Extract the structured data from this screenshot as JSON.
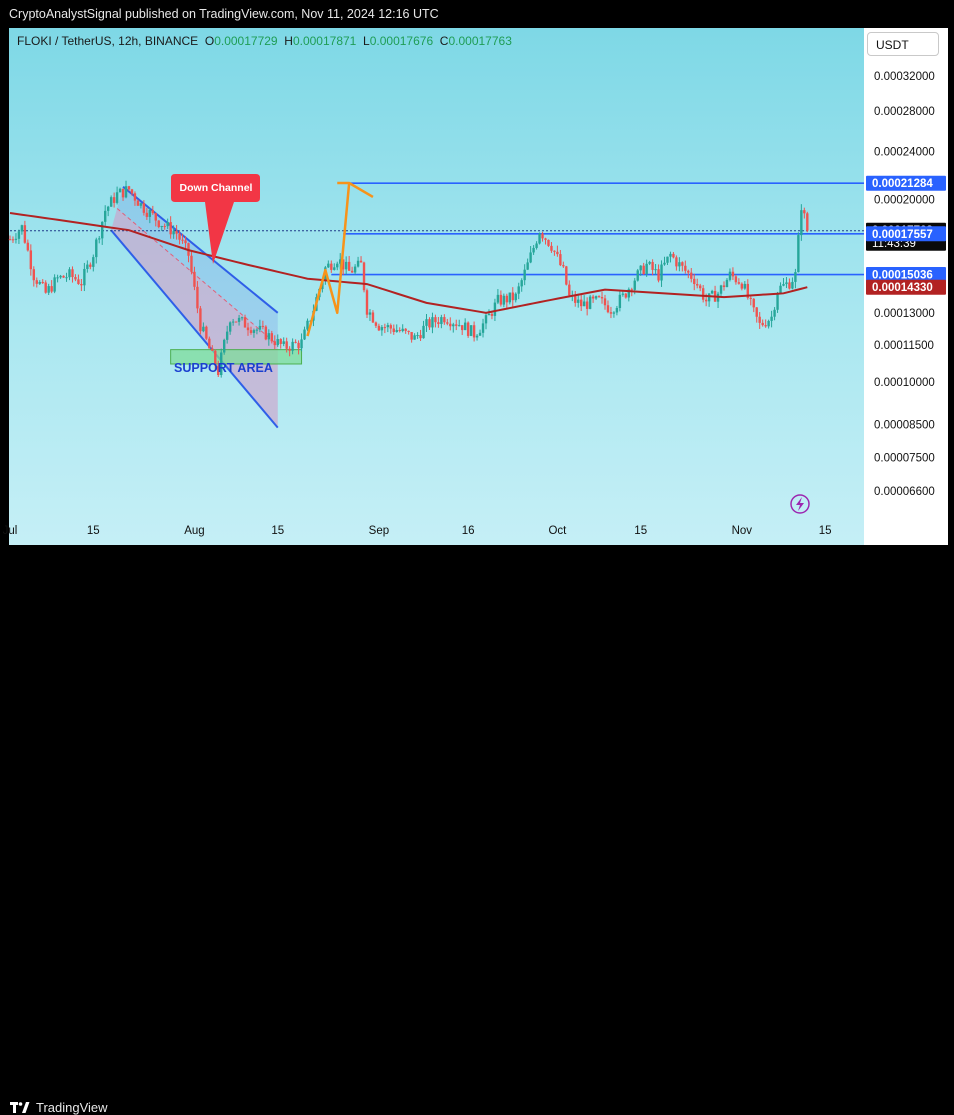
{
  "header": {
    "publisher_line": "CryptoAnalystSignal published on TradingView.com, Nov 11, 2024 12:16 UTC"
  },
  "legend": {
    "symbol": "FLOKI / TetherUS, 12h, BINANCE",
    "o_label": "O",
    "o_value": "0.00017729",
    "h_label": "H",
    "h_value": "0.00017871",
    "l_label": "L",
    "l_value": "0.00017676",
    "c_label": "C",
    "c_value": "0.00017763"
  },
  "currency_button": "USDT",
  "footer": {
    "brand": "TradingView"
  },
  "colors": {
    "up": "#26a69a",
    "down": "#ef5350",
    "ma": "#b22222",
    "level": "#2962ff",
    "arrow": "#f7931a",
    "support": "#7ddc9a",
    "channel": "#2f5fe8"
  },
  "annotations": {
    "down_channel": "Down Channel",
    "support_area": "SUPPORT AREA"
  },
  "chart_data": {
    "type": "candlestick",
    "scale": "log",
    "y_ticks": [
      {
        "value": 0.00032,
        "label": "0.00032000"
      },
      {
        "value": 0.00028,
        "label": "0.00028000"
      },
      {
        "value": 0.00024,
        "label": "0.00024000"
      },
      {
        "value": 0.0002,
        "label": "0.00020000"
      },
      {
        "value": 0.00013,
        "label": "0.00013000"
      },
      {
        "value": 0.000115,
        "label": "0.00011500"
      },
      {
        "value": 0.0001,
        "label": "0.00010000"
      },
      {
        "value": 8.5e-05,
        "label": "0.00008500"
      },
      {
        "value": 7.5e-05,
        "label": "0.00007500"
      },
      {
        "value": 6.6e-05,
        "label": "0.00006600"
      }
    ],
    "price_tags": [
      {
        "value": 0.00021284,
        "label": "0.00021284",
        "kind": "level"
      },
      {
        "value": 0.00017763,
        "label": "0.00017763",
        "sub": "11:43:39",
        "kind": "last"
      },
      {
        "value": 0.00017557,
        "label": "0.00017557",
        "kind": "level"
      },
      {
        "value": 0.00015036,
        "label": "0.00015036",
        "kind": "level"
      },
      {
        "value": 0.0001433,
        "label": "0.00014330",
        "kind": "ma"
      }
    ],
    "x_ticks": [
      {
        "day": 0,
        "label": "Jul"
      },
      {
        "day": 14,
        "label": "15"
      },
      {
        "day": 31,
        "label": "Aug"
      },
      {
        "day": 45,
        "label": "15"
      },
      {
        "day": 62,
        "label": "Sep"
      },
      {
        "day": 77,
        "label": "16"
      },
      {
        "day": 92,
        "label": "Oct"
      },
      {
        "day": 106,
        "label": "15"
      },
      {
        "day": 123,
        "label": "Nov"
      },
      {
        "day": 137,
        "label": "15"
      }
    ],
    "price_path": [
      [
        0,
        0.000172
      ],
      [
        2,
        0.00018
      ],
      [
        4,
        0.00015
      ],
      [
        6,
        0.00014
      ],
      [
        8,
        0.000148
      ],
      [
        10,
        0.00015
      ],
      [
        12,
        0.000146
      ],
      [
        14,
        0.000163
      ],
      [
        16,
        0.000192
      ],
      [
        18,
        0.000204
      ],
      [
        20,
        0.000208
      ],
      [
        22,
        0.000196
      ],
      [
        25,
        0.000184
      ],
      [
        28,
        0.000176
      ],
      [
        30,
        0.000162
      ],
      [
        32,
        0.000124
      ],
      [
        34,
        0.00011
      ],
      [
        35,
        0.000104
      ],
      [
        37,
        0.000128
      ],
      [
        40,
        0.000124
      ],
      [
        43,
        0.00012
      ],
      [
        46,
        0.000114
      ],
      [
        49,
        0.000116
      ],
      [
        51,
        0.000132
      ],
      [
        53,
        0.000154
      ],
      [
        55,
        0.00016
      ],
      [
        57,
        0.000152
      ],
      [
        59,
        0.000156
      ],
      [
        60,
        0.000132
      ],
      [
        62,
        0.000124
      ],
      [
        65,
        0.000122
      ],
      [
        68,
        0.000118
      ],
      [
        70,
        0.000124
      ],
      [
        73,
        0.000128
      ],
      [
        76,
        0.000124
      ],
      [
        78,
        0.00012
      ],
      [
        80,
        0.000126
      ],
      [
        82,
        0.000136
      ],
      [
        85,
        0.000138
      ],
      [
        87,
        0.000156
      ],
      [
        89,
        0.000178
      ],
      [
        91,
        0.000168
      ],
      [
        93,
        0.000152
      ],
      [
        94,
        0.000138
      ],
      [
        96,
        0.000134
      ],
      [
        99,
        0.000136
      ],
      [
        101,
        0.000132
      ],
      [
        103,
        0.000138
      ],
      [
        105,
        0.000148
      ],
      [
        107,
        0.000156
      ],
      [
        109,
        0.00015
      ],
      [
        111,
        0.000162
      ],
      [
        113,
        0.000154
      ],
      [
        115,
        0.000148
      ],
      [
        117,
        0.000136
      ],
      [
        119,
        0.00014
      ],
      [
        121,
        0.00015
      ],
      [
        123,
        0.000146
      ],
      [
        125,
        0.00013
      ],
      [
        126,
        0.000124
      ],
      [
        128,
        0.000128
      ],
      [
        129,
        0.000142
      ],
      [
        131,
        0.000146
      ],
      [
        132,
        0.00015
      ],
      [
        133,
        0.000196
      ],
      [
        134,
        0.000178
      ]
    ],
    "ma_path": [
      [
        0,
        0.00019
      ],
      [
        10,
        0.000184
      ],
      [
        20,
        0.000178
      ],
      [
        30,
        0.000165
      ],
      [
        40,
        0.000156
      ],
      [
        50,
        0.000148
      ],
      [
        60,
        0.000145
      ],
      [
        70,
        0.000135
      ],
      [
        80,
        0.00013
      ],
      [
        90,
        0.000136
      ],
      [
        100,
        0.000142
      ],
      [
        110,
        0.00014
      ],
      [
        120,
        0.000138
      ],
      [
        130,
        0.00014
      ],
      [
        134,
        0.0001433
      ]
    ],
    "levels": [
      {
        "value": 0.00021284,
        "from_day": 56,
        "style": "solid"
      },
      {
        "value": 0.00017557,
        "from_day": 56,
        "style": "solid"
      },
      {
        "value": 0.00015036,
        "from_day": 54,
        "style": "solid"
      },
      {
        "value": 0.00017763,
        "from_day": 0,
        "style": "dotted"
      }
    ],
    "down_channel": {
      "upper": [
        [
          19,
          0.00021
        ],
        [
          45,
          0.00013
        ]
      ],
      "lower": [
        [
          17,
          0.000178
        ],
        [
          45,
          8.4e-05
        ]
      ]
    },
    "support_area": {
      "from_day": 27,
      "to_day": 49,
      "low": 0.000107,
      "high": 0.000113
    },
    "projection_arrow": [
      [
        50,
        0.000119
      ],
      [
        53,
        0.000153
      ],
      [
        55,
        0.00013
      ],
      [
        57,
        0.000213
      ],
      [
        61,
        0.000202
      ]
    ]
  }
}
